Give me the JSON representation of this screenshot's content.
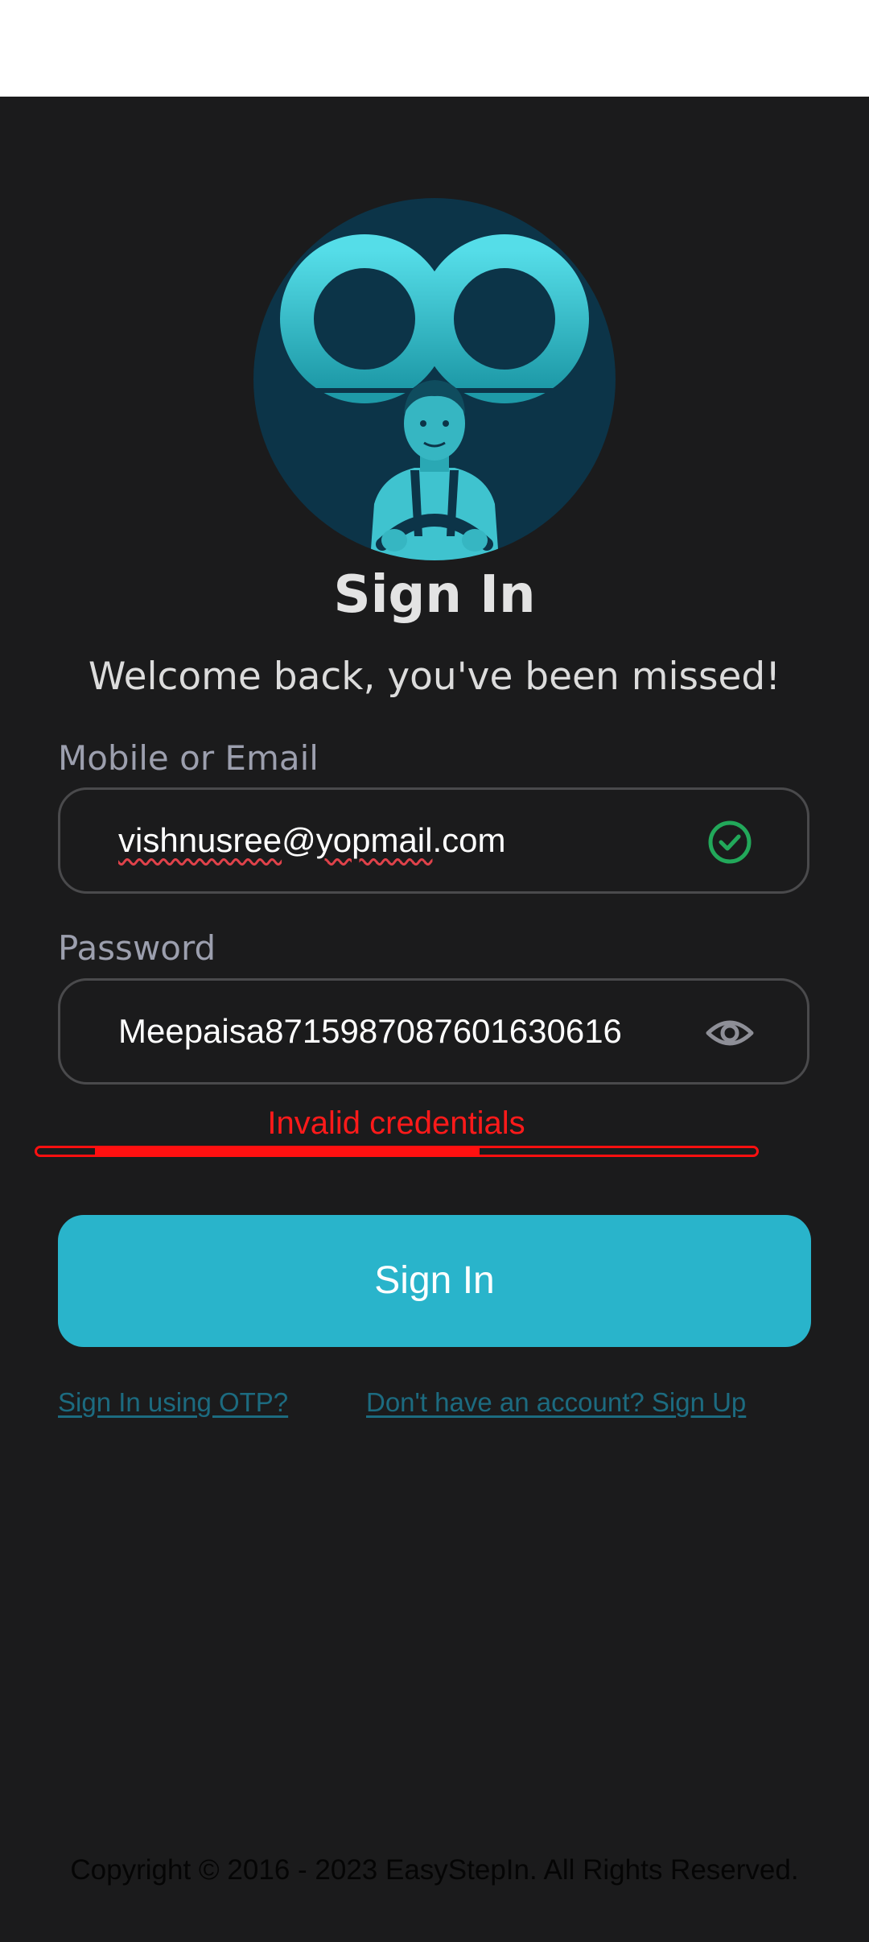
{
  "header": {
    "title": "Sign In",
    "subtitle": "Welcome back, you've been missed!"
  },
  "form": {
    "email_label": "Mobile or Email",
    "email_value_parts": [
      "vishnusree",
      "@",
      "yopmail",
      ".com"
    ],
    "email_status_icon": "check-circle-icon",
    "password_label": "Password",
    "password_value": "Meepaisa8715987087601630616",
    "password_toggle_icon": "eye-icon",
    "error_message": "Invalid credentials",
    "progress": 0.48
  },
  "actions": {
    "signin_label": "Sign In",
    "otp_link": "Sign In using OTP?",
    "signup_link": "Don't have an account? Sign Up"
  },
  "footer": {
    "copyright": "Copyright © 2016 - 2023  EasyStepIn. All Rights Reserved."
  },
  "colors": {
    "background": "#1b1b1c",
    "accent": "#29b4cb",
    "error": "#ff1010",
    "success": "#22a85a",
    "link": "#1c6b80"
  }
}
